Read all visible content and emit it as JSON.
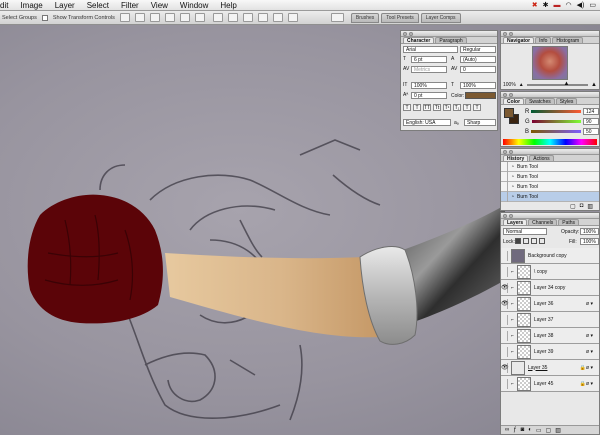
{
  "menubar": {
    "items": [
      "dit",
      "Image",
      "Layer",
      "Select",
      "Filter",
      "View",
      "Window",
      "Help"
    ],
    "status_icons": [
      "bluetooth-icon",
      "flag-icon",
      "wifi-icon",
      "volume-icon"
    ]
  },
  "options_bar": {
    "select_groups": "Select Groups",
    "show_transform": "Show Transform Controls",
    "well_tabs": [
      "Brushes",
      "Tool Presets",
      "Layer Comps"
    ]
  },
  "character": {
    "tabs": [
      "Character",
      "Paragraph"
    ],
    "font_family": "Arial",
    "font_style": "Regular",
    "size": "6 pt",
    "leading": "(Auto)",
    "kerning": "Metrics",
    "tracking": "0",
    "vscale": "100%",
    "hscale": "100%",
    "baseline": "0 pt",
    "color_label": "Color:",
    "glyphs": [
      "T",
      "T",
      "TT",
      "Tt",
      "T¹",
      "T₁",
      "T",
      "T"
    ],
    "language": "English: USA",
    "aa_label": "aₐ",
    "antialias": "Sharp"
  },
  "navigator": {
    "tabs": [
      "Navigator",
      "Info",
      "Histogram"
    ],
    "zoom": "100%"
  },
  "color": {
    "tabs": [
      "Color",
      "Swatches",
      "Styles"
    ],
    "channels": [
      {
        "name": "R",
        "value": "124"
      },
      {
        "name": "G",
        "value": "90"
      },
      {
        "name": "B",
        "value": "50"
      }
    ],
    "fg": "#7c5a32",
    "bg": "#3b2410"
  },
  "history": {
    "tabs": [
      "History",
      "Actions"
    ],
    "items": [
      "Burn Tool",
      "Burn Tool",
      "Burn Tool",
      "Burn Tool"
    ]
  },
  "layers": {
    "tabs": [
      "Layers",
      "Channels",
      "Paths"
    ],
    "blend_mode": "Normal",
    "opacity_label": "Opacity:",
    "opacity": "100%",
    "lock_label": "Lock:",
    "fill_label": "Fill:",
    "fill": "100%",
    "items": [
      {
        "name": "Background copy",
        "eye": "",
        "badge": ""
      },
      {
        "name": "\\ copy",
        "eye": "",
        "badge": ""
      },
      {
        "name": "Layer 34 copy",
        "eye": "👁",
        "badge": ""
      },
      {
        "name": "Layer 36",
        "eye": "👁",
        "badge": "ø ▾"
      },
      {
        "name": "Layer 37",
        "eye": "",
        "badge": ""
      },
      {
        "name": "Layer 38",
        "eye": "",
        "badge": "ø ▾"
      },
      {
        "name": "Layer 39",
        "eye": "",
        "badge": "ø ▾"
      },
      {
        "name": "Layer 35",
        "eye": "👁",
        "badge": "🔒ø ▾"
      },
      {
        "name": "Layer 45",
        "eye": "",
        "badge": "🔒ø ▾"
      }
    ]
  }
}
